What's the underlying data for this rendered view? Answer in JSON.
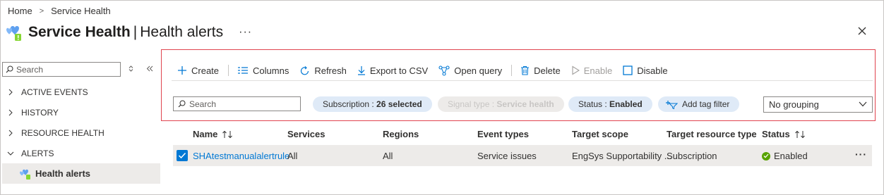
{
  "breadcrumb": {
    "home": "Home",
    "current": "Service Health"
  },
  "header": {
    "title_main": "Service Health",
    "title_sub": "Health alerts",
    "more": "···",
    "close_icon": "close-icon"
  },
  "sidebar": {
    "search_placeholder": "Search",
    "items": [
      {
        "label": "ACTIVE EVENTS",
        "expanded": false
      },
      {
        "label": "HISTORY",
        "expanded": false
      },
      {
        "label": "RESOURCE HEALTH",
        "expanded": false
      },
      {
        "label": "ALERTS",
        "expanded": true
      },
      {
        "label": "Health alerts",
        "selected": true
      }
    ]
  },
  "toolbar": {
    "create": "Create",
    "columns": "Columns",
    "refresh": "Refresh",
    "export": "Export to CSV",
    "open_query": "Open query",
    "delete": "Delete",
    "enable": "Enable",
    "disable": "Disable"
  },
  "filters": {
    "search_placeholder": "Search",
    "subscription_label": "Subscription : ",
    "subscription_value": "26 selected",
    "signal_label": "Signal type : ",
    "signal_value": "Service health",
    "status_label": "Status : ",
    "status_value": "Enabled",
    "add_tag": "Add tag filter",
    "grouping": "No grouping"
  },
  "table": {
    "columns": [
      "Name",
      "Services",
      "Regions",
      "Event types",
      "Target scope",
      "Target resource type",
      "Status"
    ],
    "rows": [
      {
        "name": "SHAtestmanualalertrule",
        "services": "All",
        "regions": "All",
        "event_types": "Service issues",
        "target_scope": "EngSys Supportability ...",
        "target_resource_type": "Subscription",
        "status": "Enabled",
        "selected": true
      }
    ]
  },
  "colors": {
    "accent": "#0078d4",
    "pill": "#dfeaf7",
    "highlight_border": "#e0444f",
    "status_ok": "#57a300"
  }
}
